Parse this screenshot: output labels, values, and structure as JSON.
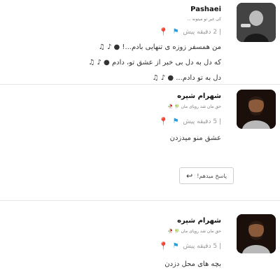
{
  "comments": [
    {
      "name": "Pashaei",
      "bio": "کی غیر تو میتونه ...",
      "time": "| 2 دقیقه پیش",
      "lines": [
        "من همسفر زوزه ی تنهایی بادم...! ● ♪ ♫",
        "که دل به دل بی خبر از عشق تو، دادم ● ♪ ♫",
        "دل به تو دادم... ● ♪ ♫"
      ],
      "pin_icon": "pin-icon",
      "flag_icon": "flag-icon"
    },
    {
      "name": "شهرام شپره",
      "bio": "حق مان شد رویای مان 🎋 🥀",
      "time": "| 5 دقیقه پیش",
      "lines": [
        "عشق منو میدزدن"
      ],
      "reply_label": "پاسخ میدهم!",
      "pin_icon": "pin-icon",
      "flag_icon": "flag-icon"
    },
    {
      "name": "شهرام شپره",
      "bio": "حق مان شد رویای مان 🎋 🥀",
      "time": "| 5 دقیقه پیش",
      "lines": [
        "بچه های محل دزدن"
      ],
      "pin_icon": "pin-icon",
      "flag_icon": "flag-icon"
    }
  ]
}
